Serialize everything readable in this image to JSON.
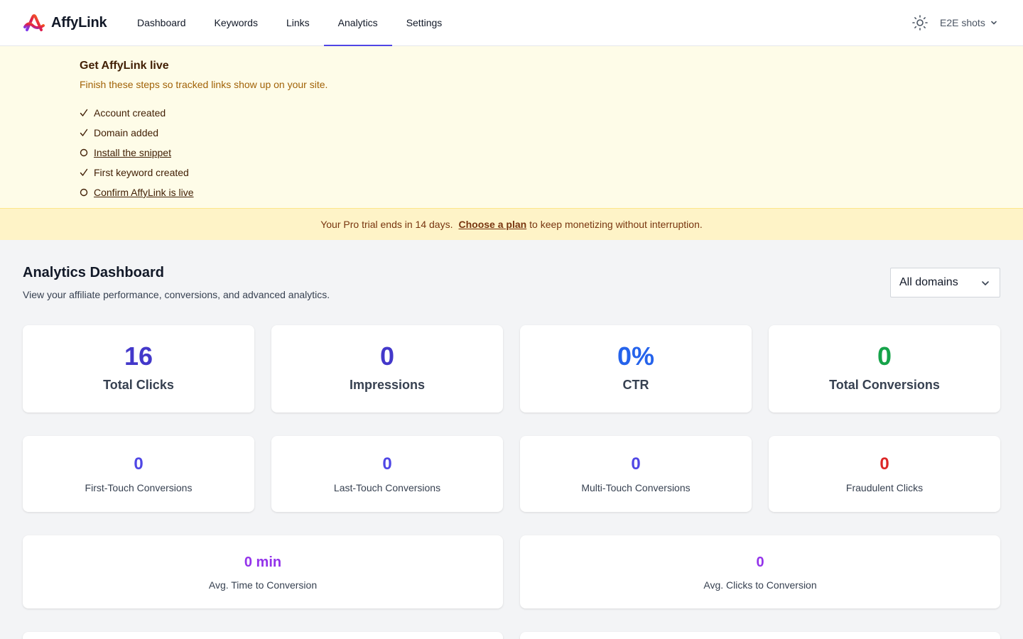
{
  "app": {
    "name": "AffyLink"
  },
  "nav": {
    "items": [
      {
        "label": "Dashboard",
        "active": false
      },
      {
        "label": "Keywords",
        "active": false
      },
      {
        "label": "Links",
        "active": false
      },
      {
        "label": "Analytics",
        "active": true
      },
      {
        "label": "Settings",
        "active": false
      }
    ],
    "account_label": "E2E shots",
    "theme_icon": "sun-icon"
  },
  "onboarding": {
    "title": "Get AffyLink live",
    "subtitle": "Finish these steps so tracked links show up on your site.",
    "steps": [
      {
        "label": "Account created",
        "done": true
      },
      {
        "label": "Domain added",
        "done": true
      },
      {
        "label": "Install the snippet",
        "done": false
      },
      {
        "label": "First keyword created",
        "done": true
      },
      {
        "label": "Confirm AffyLink is live",
        "done": false
      }
    ]
  },
  "trial": {
    "prefix": "Your Pro trial ends in 14 days.",
    "link": "Choose a plan",
    "suffix": "to keep monetizing without interruption."
  },
  "dashboard": {
    "title": "Analytics Dashboard",
    "subtitle": "View your affiliate performance, conversions, and advanced analytics.",
    "domain_filter": "All domains"
  },
  "stats": {
    "primary": [
      {
        "value": "16",
        "label": "Total Clicks",
        "color": "#4338ca"
      },
      {
        "value": "0",
        "label": "Impressions",
        "color": "#4338ca"
      },
      {
        "value": "0%",
        "label": "CTR",
        "color": "#2563eb"
      },
      {
        "value": "0",
        "label": "Total Conversions",
        "color": "#16a34a"
      }
    ],
    "secondary": [
      {
        "value": "0",
        "label": "First-Touch Conversions",
        "color": "#4f46e5"
      },
      {
        "value": "0",
        "label": "Last-Touch Conversions",
        "color": "#4f46e5"
      },
      {
        "value": "0",
        "label": "Multi-Touch Conversions",
        "color": "#4f46e5"
      },
      {
        "value": "0",
        "label": "Fraudulent Clicks",
        "color": "#dc2626"
      }
    ],
    "tertiary": [
      {
        "value": "0 min",
        "label": "Avg. Time to Conversion",
        "color": "#9333ea"
      },
      {
        "value": "0",
        "label": "Avg. Clicks to Conversion",
        "color": "#9333ea"
      }
    ]
  },
  "colors": {
    "accent": "#4f46e5",
    "banner_bg": "#fefce8",
    "trial_bg": "#fef3c7"
  }
}
